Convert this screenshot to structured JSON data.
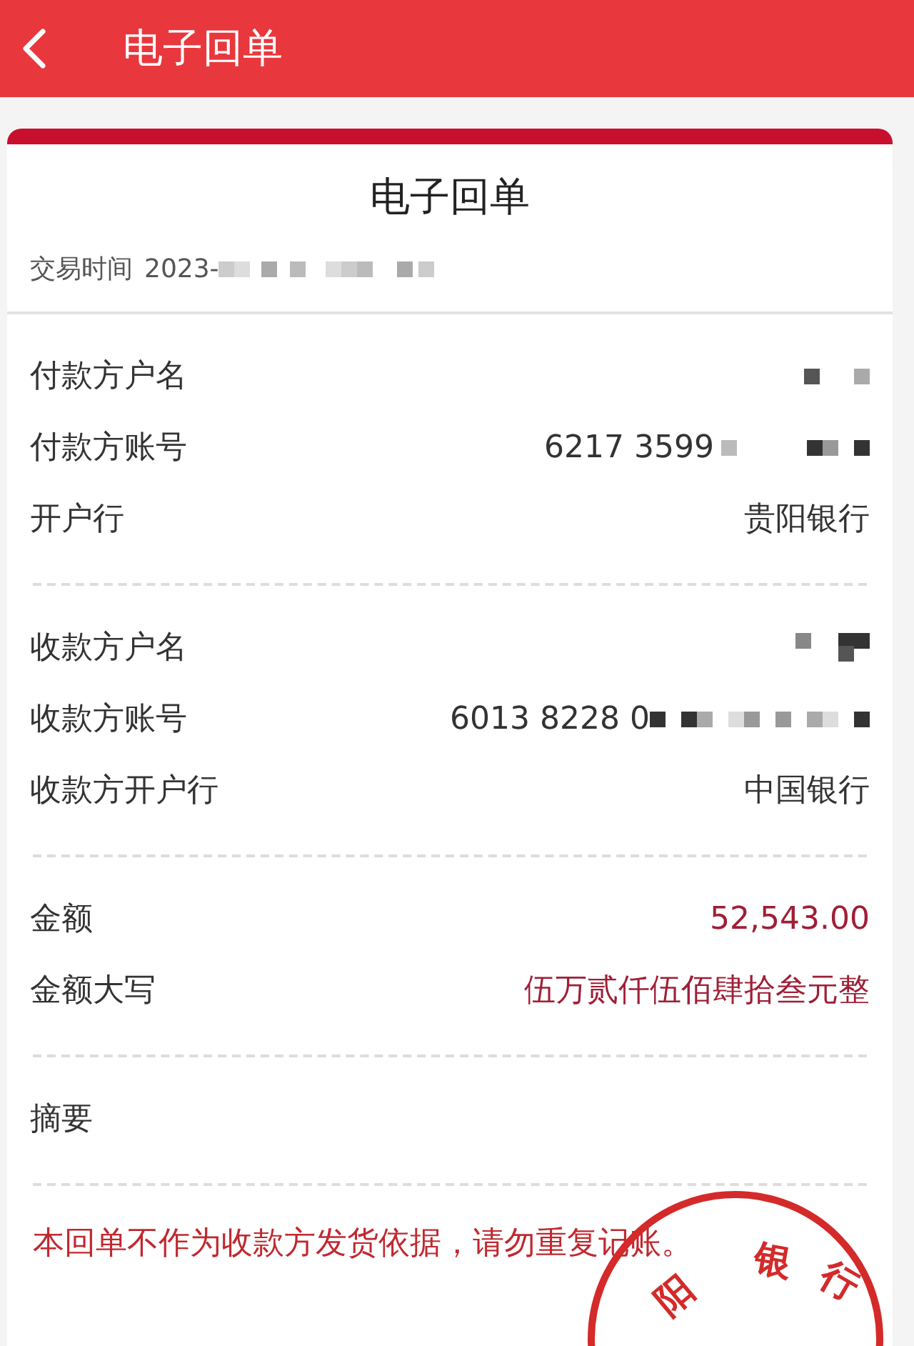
{
  "header": {
    "title": "电子回单"
  },
  "receipt": {
    "title": "电子回单",
    "time_label": "交易时间",
    "time_value": "2023-",
    "time_redacted": true
  },
  "sections": [
    {
      "rows": [
        {
          "label": "付款方户名",
          "redacted": true
        },
        {
          "label": "付款方账号",
          "value": "6217 3599",
          "kind": "plain",
          "redacted": true
        },
        {
          "label": "开户行",
          "value": "贵阳银行",
          "kind": "plain",
          "redacted": false
        }
      ]
    },
    {
      "rows": [
        {
          "label": "收款方户名",
          "redacted": true
        },
        {
          "label": "收款方账号",
          "value": "6013 8228 0",
          "kind": "plain",
          "redacted": true
        },
        {
          "label": "收款方开户行",
          "value": "中国银行",
          "kind": "plain",
          "redacted": false
        }
      ]
    },
    {
      "rows": [
        {
          "label": "金额",
          "value": "52,543.00",
          "kind": "amount",
          "redacted": false
        },
        {
          "label": "金额大写",
          "value": "伍万贰仟伍佰肆拾叁元整",
          "kind": "amount",
          "redacted": false
        }
      ]
    },
    {
      "rows": [
        {
          "label": "摘要",
          "redacted": false
        }
      ]
    }
  ],
  "notice": "本回单不作为收款方发货依据，请勿重复记账。",
  "stamp": {
    "chars": [
      "阳",
      "银",
      "行"
    ]
  }
}
